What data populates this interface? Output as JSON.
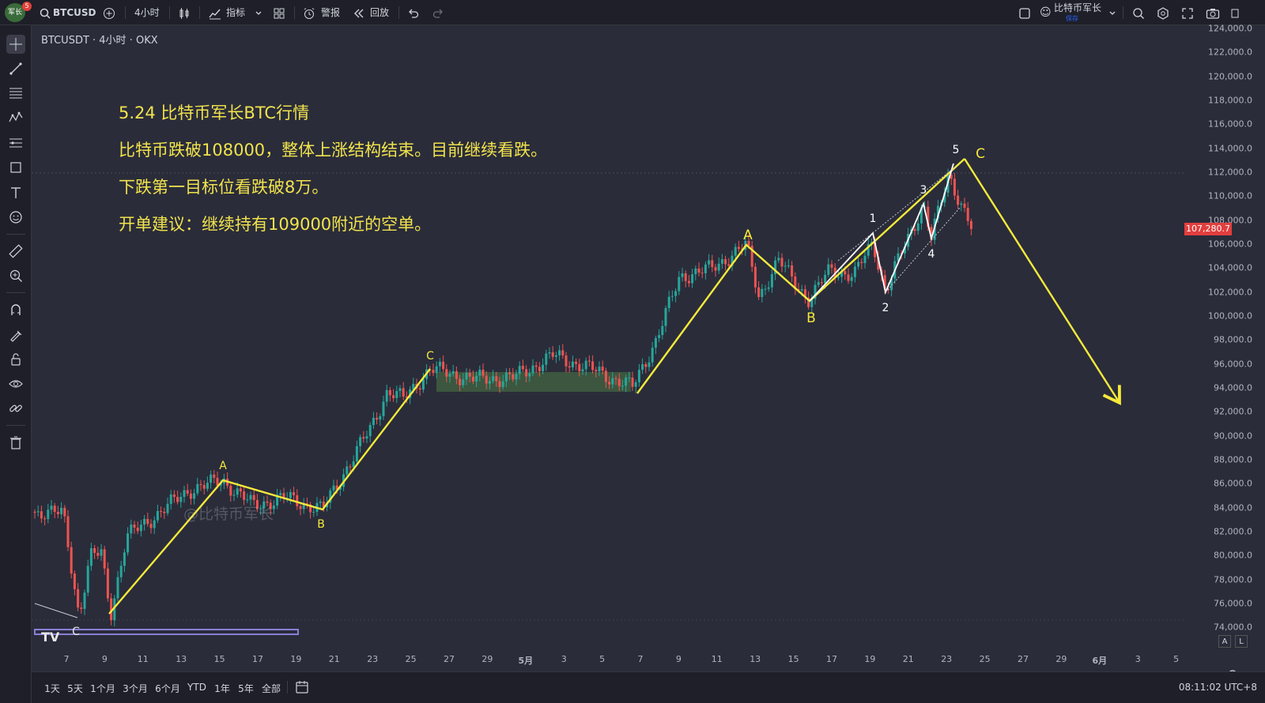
{
  "topbar": {
    "avatar_label": "军长",
    "notification_count": "5",
    "symbol": "BTCUSD",
    "interval": "4小时",
    "indicators_label": "指标",
    "alerts_label": "警报",
    "replay_label": "回放",
    "layout_name": "比特币军长",
    "layout_status": "保存"
  },
  "chart_header": {
    "title": "BTCUSDT · 4小时 · OKX"
  },
  "annotations": [
    "5.24 比特币军长BTC行情",
    "比特币跌破108000，整体上涨结构结束。目前继续看跌。",
    "下跌第一目标位看跌破8万。",
    "开单建议：继续持有109000附近的空单。"
  ],
  "watermark": "@比特币军长",
  "logo": "TV",
  "wave_labels": {
    "start_c": "C",
    "a1": "A",
    "b1": "B",
    "c1": "C",
    "a2": "A",
    "b2": "B",
    "w1": "1",
    "w2": "2",
    "w3": "3",
    "w4": "4",
    "w5": "5",
    "c2": "C"
  },
  "price_axis": {
    "labels": [
      "124,000.0",
      "122,000.0",
      "120,000.0",
      "118,000.0",
      "116,000.0",
      "114,000.0",
      "112,000.0",
      "110,000.0",
      "108,000.0",
      "106,000.0",
      "104,000.0",
      "102,000.0",
      "100,000.0",
      "98,000.0",
      "96,000.0",
      "94,000.0",
      "92,000.0",
      "90,000.0",
      "88,000.0",
      "86,000.0",
      "84,000.0",
      "82,000.0",
      "80,000.0",
      "78,000.0",
      "76,000.0",
      "74,000.0"
    ],
    "current_price": "107,280.7",
    "current_price_value": 107280.7
  },
  "time_axis": {
    "labels": [
      "7",
      "9",
      "11",
      "13",
      "15",
      "17",
      "19",
      "21",
      "23",
      "25",
      "27",
      "29",
      "5月",
      "3",
      "5",
      "7",
      "9",
      "11",
      "13",
      "15",
      "17",
      "19",
      "21",
      "23",
      "25",
      "27",
      "29",
      "6月",
      "3",
      "5"
    ]
  },
  "bottom_bar": {
    "ranges": [
      "1天",
      "5天",
      "1个月",
      "3个月",
      "6个月",
      "YTD",
      "1年",
      "5年",
      "全部"
    ],
    "time": "08:11:02 UTC+8"
  },
  "scale_buttons": {
    "auto": "A",
    "log": "L"
  },
  "colors": {
    "background": "#2a2c3a",
    "toolbar": "#1e1f28",
    "up_candle": "#26a69a",
    "down_candle": "#ef5350",
    "annotation": "#f1e34c",
    "wave_line": "#f5ea3a",
    "price_tag": "#e23e3e"
  },
  "icons": [
    "search-icon",
    "plus-circle-icon",
    "candles-icon",
    "indicator-icon",
    "templates-icon",
    "alert-clock-icon",
    "replay-icon",
    "undo-icon",
    "redo-icon",
    "layout-square-icon",
    "chevron-down-icon",
    "quick-search-icon",
    "settings-icon",
    "fullscreen-icon",
    "camera-icon",
    "crosshair-icon",
    "trendline-icon",
    "fib-icon",
    "pattern-icon",
    "forecast-icon",
    "geometry-icon",
    "text-icon",
    "emoji-icon",
    "ruler-icon",
    "zoom-icon",
    "magnet-icon",
    "lock-draw-icon",
    "lock-icon",
    "eye-icon",
    "link-icon",
    "trash-icon",
    "calendar-icon",
    "gear-icon"
  ]
}
